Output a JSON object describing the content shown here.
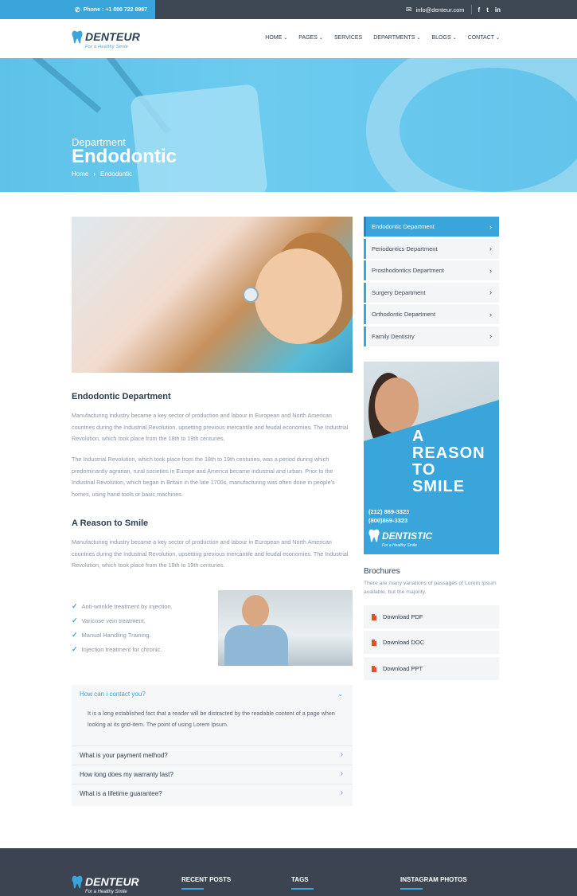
{
  "topbar": {
    "phone": "Phone : +1 800 722 8987",
    "email": "info@denteur.com",
    "social": [
      "f",
      "t",
      "in"
    ]
  },
  "brand": {
    "name": "DENTEUR",
    "tagline": "For a Healthy Smile",
    "accent_color": "#3aa5db",
    "dark_color": "#2d3e50"
  },
  "nav": {
    "items": [
      {
        "label": "HOME",
        "dropdown": true
      },
      {
        "label": "PAGES",
        "dropdown": true
      },
      {
        "label": "SERVICES",
        "dropdown": false
      },
      {
        "label": "DEPARTMENTS",
        "dropdown": true
      },
      {
        "label": "BLOGS",
        "dropdown": true
      },
      {
        "label": "CONTACT",
        "dropdown": true
      }
    ]
  },
  "hero": {
    "subtitle": "Department",
    "title": "Endodontic",
    "breadcrumb": [
      "Home",
      "›",
      "Endodontic"
    ]
  },
  "main": {
    "section1_title": "Endodontic Department",
    "section1_p1": "Manufacturing industry became a key sector of production and labour in European and North American countries during the Industrial Revolution, upsetting previous mercantile and feudal economies. The Industrial Revolution, which took place from the 18th to 19th centuries.",
    "section1_p2": "The Industrial Revolution, which took place from the 18th to 19th centuries, was a period during which predominantly agrarian, rural societies in Europe and America became industrial and urban. Prior to the Industrial Revolution, which began in Britain in the late 1700s, manufacturing was often done in people's homes, using hand tools or basic machines.",
    "section2_title": "A Reason to Smile",
    "section2_p1": "Manufacturing industry became a key sector of production and labour in European and North American countries during the Industrial Revolution, upsetting previous mercantile and feudal economies. The Industrial Revolution, which took place from the 18th to 19th centuries.",
    "checklist": [
      "Anti-wrinkle treatment by injection.",
      "Varicose vein treatment.",
      "Manual Handling Training.",
      "Injection treatment for chronic."
    ]
  },
  "faq": {
    "open_question": "How can i contact you?",
    "open_answer": "It is a long established fact that a reader will be distracted by the readable content of a page when looking at its grid-item. The point of using Lorem Ipsum.",
    "questions": [
      "What is your payment method?",
      "How long does my warranty last?",
      "What is a lifetime guarantee?"
    ]
  },
  "sidebar": {
    "departments": [
      {
        "label": "Endodontic Department",
        "active": true
      },
      {
        "label": "Periodontics Department",
        "active": false
      },
      {
        "label": "Prosthodontics Department",
        "active": false
      },
      {
        "label": "Surgery Department",
        "active": false
      },
      {
        "label": "Orthodontic Department",
        "active": false
      },
      {
        "label": "Family Dentistry",
        "active": false
      }
    ],
    "promo": {
      "title_lines": [
        "A",
        "REASON",
        "TO",
        "SMILE"
      ],
      "phone1": "(212) 869-3323",
      "phone2": "(800)869-3323",
      "brand": "DENTISTIC",
      "tagline": "For a Healthy Smile"
    },
    "brochures": {
      "title": "Brochures",
      "description": "There are many variations of passages of Lorem Ipsum available, but the majority.",
      "downloads": [
        "Download PDF",
        "Download DOC",
        "Download PPT"
      ]
    }
  },
  "footer": {
    "brand": "DENTEUR",
    "tagline": "For a Healthy Smile",
    "columns": [
      "RECENT POSTS",
      "TAGS",
      "INSTAGRAM PHOTOS"
    ]
  }
}
